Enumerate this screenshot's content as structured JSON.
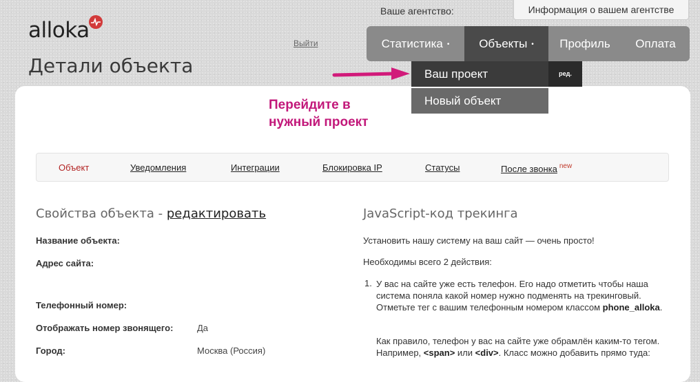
{
  "brand": {
    "name": "alloka",
    "accent": "#d23a3a"
  },
  "header": {
    "logout": "Выйти",
    "page_title": "Детали объекта",
    "agency_label": "Ваше агентство:",
    "agency_button": "Информация о вашем агентстве"
  },
  "nav": {
    "items": [
      {
        "label": "Статистика",
        "caret": "•"
      },
      {
        "label": "Объекты",
        "caret": "•"
      },
      {
        "label": "Профиль"
      },
      {
        "label": "Оплата"
      }
    ]
  },
  "dropdown": {
    "project": "Ваш проект",
    "edit": "ред.",
    "new_object": "Новый объект"
  },
  "hint": {
    "line1": "Перейдите в",
    "line2": "нужный проект",
    "color": "#c2187a"
  },
  "tabs": [
    {
      "label": "Объект"
    },
    {
      "label": "Уведомления"
    },
    {
      "label": "Интеграции"
    },
    {
      "label": "Блокировка IP"
    },
    {
      "label": "Статусы"
    },
    {
      "label": "После звонка",
      "badge": "new"
    }
  ],
  "properties": {
    "title": "Свойства объекта - ",
    "edit_link": "редактировать",
    "rows": [
      {
        "label": "Название объекта:",
        "value": ""
      },
      {
        "label": "Адрес сайта:",
        "value": ""
      },
      {
        "label": "Телефонный номер:",
        "value": ""
      },
      {
        "label": "Отображать номер звонящего:",
        "value": "Да"
      },
      {
        "label": "Город:",
        "value": "Москва (Россия)"
      }
    ]
  },
  "js_tracking": {
    "title": "JavaScript-код трекинга",
    "intro": "Установить нашу систему на ваш сайт — очень просто!",
    "steps_intro": "Необходимы всего 2 действия:",
    "step_number": "1.",
    "step1_text": "У вас на сайте уже есть телефон. Его надо отметить чтобы наша система поняла какой номер нужно подменять на трекинговый. Отметьте тег с вашим телефонным номером классом ",
    "step1_class": "phone_alloka",
    "step1_end": ".",
    "step1_note_a": "Как правило, телефон у вас на сайте уже обрамлён каким-то тегом. Например, ",
    "tag_span": "<span>",
    "or": " или ",
    "tag_div": "<div>",
    "step1_note_b": ". Класс можно добавить прямо туда:"
  }
}
